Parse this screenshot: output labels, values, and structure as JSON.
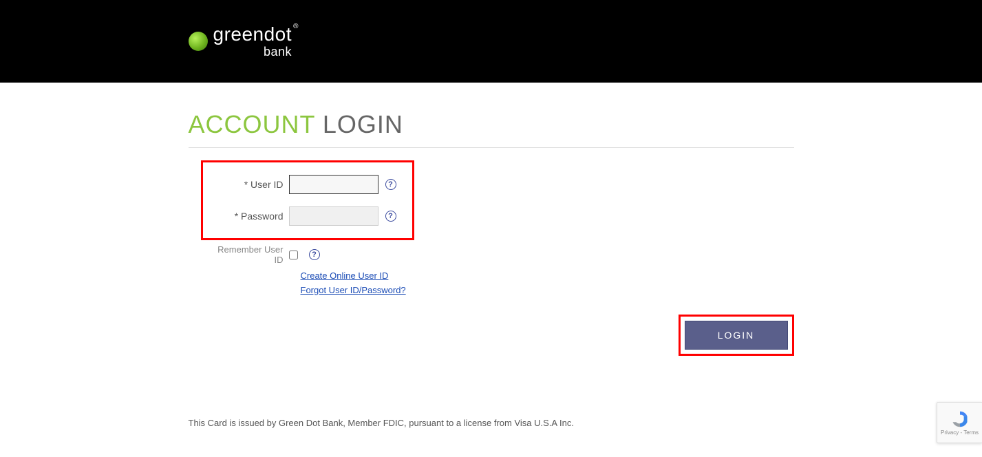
{
  "brand": {
    "name": "greendot",
    "sub": "bank",
    "trademark": "®"
  },
  "page": {
    "title_account": "ACCOUNT",
    "title_login": "LOGIN"
  },
  "form": {
    "userid_label": "* User ID",
    "password_label": "* Password",
    "remember_label": "Remember User ID",
    "create_link": "Create Online User ID",
    "forgot_link": "Forgot User ID/Password?",
    "login_button": "LOGIN",
    "help_glyph": "?"
  },
  "footer": {
    "disclaimer": "This Card is issued by Green Dot Bank, Member FDIC, pursuant to a license from Visa U.S.A Inc."
  },
  "recaptcha": {
    "privacy": "Privacy",
    "terms": "Terms",
    "sep": " - "
  }
}
